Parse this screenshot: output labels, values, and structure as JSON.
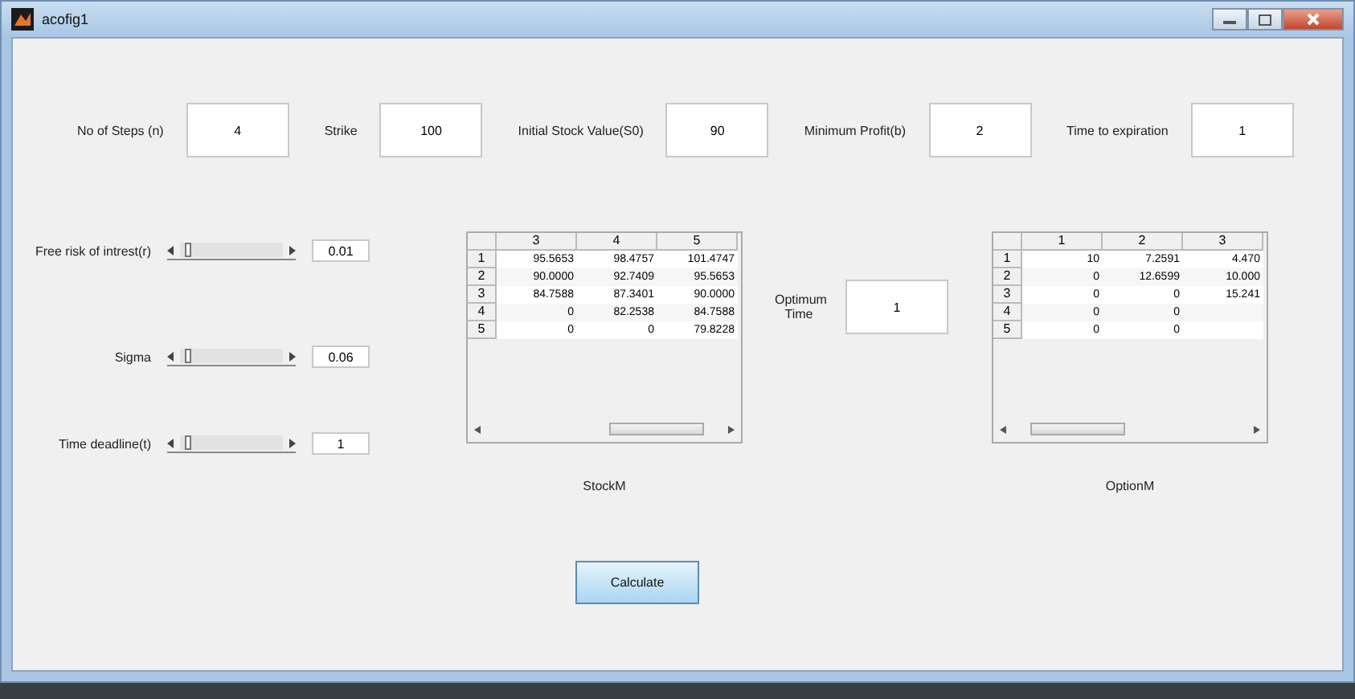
{
  "window": {
    "title": "acofig1"
  },
  "inputs": [
    {
      "label": "No of Steps (n)",
      "value": "4"
    },
    {
      "label": "Strike",
      "value": "100"
    },
    {
      "label": "Initial Stock Value(S0)",
      "value": "90"
    },
    {
      "label": "Minimum Profit(b)",
      "value": "2"
    },
    {
      "label": "Time to expiration",
      "value": "1"
    }
  ],
  "sliders": [
    {
      "label": "Free risk of intrest(r)",
      "level": 0.05,
      "value": "0.01"
    },
    {
      "label": "Sigma",
      "level": 0.05,
      "value": "0.06"
    },
    {
      "label": "Time deadline(t)",
      "level": 0.05,
      "value": "1"
    }
  ],
  "tables": [
    {
      "caption": "StockM",
      "columns": [
        "3",
        "4",
        "5"
      ],
      "rows": [
        {
          "label": "1",
          "cells": [
            "95.5653",
            "98.4757",
            "101.4747"
          ]
        },
        {
          "label": "2",
          "cells": [
            "90.0000",
            "92.7409",
            "95.5653"
          ]
        },
        {
          "label": "3",
          "cells": [
            "84.7588",
            "87.3401",
            "90.0000"
          ]
        },
        {
          "label": "4",
          "cells": [
            "0",
            "82.2538",
            "84.7588"
          ]
        },
        {
          "label": "5",
          "cells": [
            "0",
            "0",
            "79.8228"
          ]
        }
      ]
    },
    {
      "caption": "OptionM",
      "columns": [
        "1",
        "2",
        "3"
      ],
      "rows": [
        {
          "label": "1",
          "cells": [
            "10",
            "7.2591",
            "4.470"
          ]
        },
        {
          "label": "2",
          "cells": [
            "0",
            "12.6599",
            "10.000"
          ]
        },
        {
          "label": "3",
          "cells": [
            "0",
            "0",
            "15.241"
          ]
        },
        {
          "label": "4",
          "cells": [
            "0",
            "0",
            null
          ]
        },
        {
          "label": "5",
          "cells": [
            "0",
            "0",
            null
          ]
        }
      ]
    }
  ],
  "optimum": {
    "label": "Optimum Time",
    "value": "1"
  },
  "buttons": [
    "Calculate"
  ]
}
